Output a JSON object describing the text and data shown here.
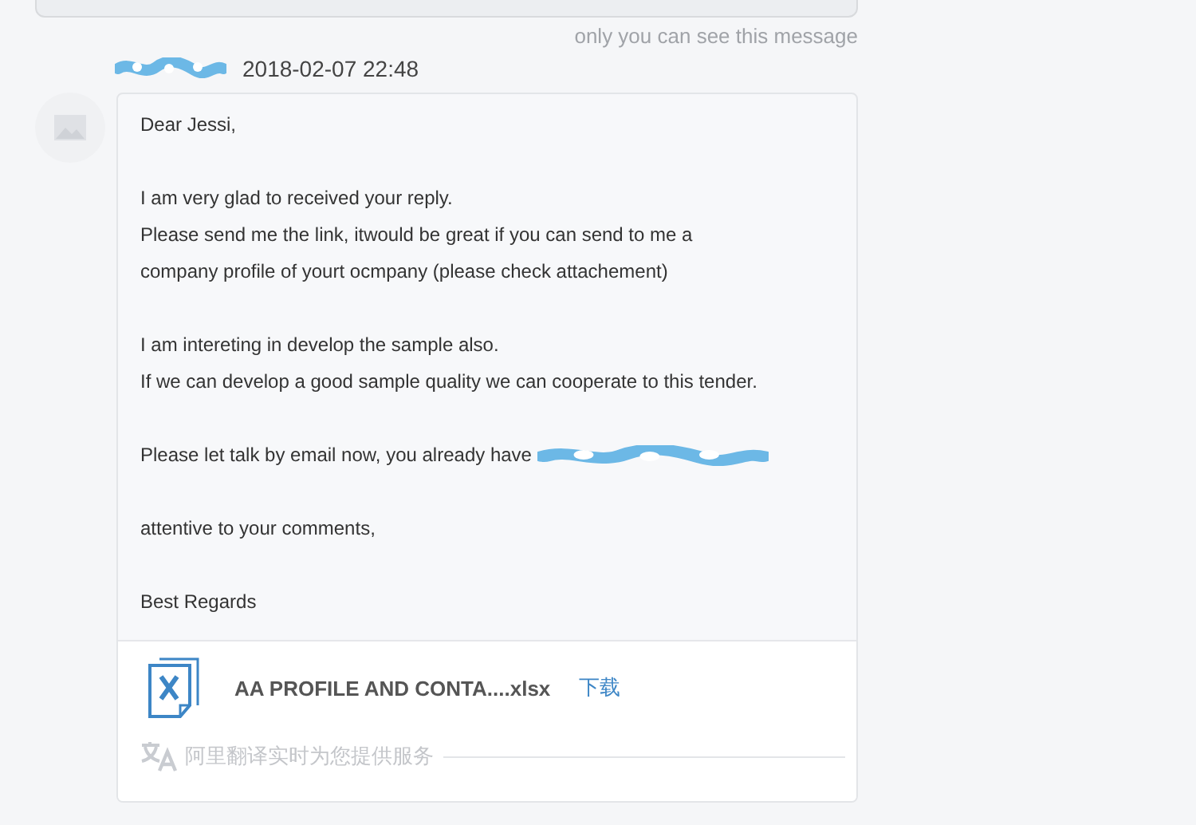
{
  "previous_message": {
    "note": "only you can see this message"
  },
  "message": {
    "sender_redacted": true,
    "time": "2018-02-07 22:48",
    "paragraphs": [
      {
        "lines": [
          "Dear Jessi,"
        ],
        "redacted_email": false
      },
      {
        "lines": [
          "I am very glad to received your reply.",
          "Please send me the link, itwould be great if you can send to me a",
          "company profile of yourt ocmpany (please check attachement)"
        ],
        "redacted_email": false
      },
      {
        "lines": [
          "I am intereting in develop the sample also.",
          "If we can develop a good sample quality we can cooperate to this tender."
        ],
        "redacted_email": false
      },
      {
        "lines": [
          "Please let talk by email now, you already have"
        ],
        "redacted_email": true
      },
      {
        "lines": [
          "attentive to your comments,"
        ],
        "redacted_email": false
      },
      {
        "lines": [
          "Best Regards"
        ],
        "redacted_email": false
      }
    ],
    "attachment": {
      "name": "AA PROFILE AND CONTA....xlsx",
      "download": "下载"
    },
    "translation_note": "阿里翻译实时为您提供服务"
  }
}
